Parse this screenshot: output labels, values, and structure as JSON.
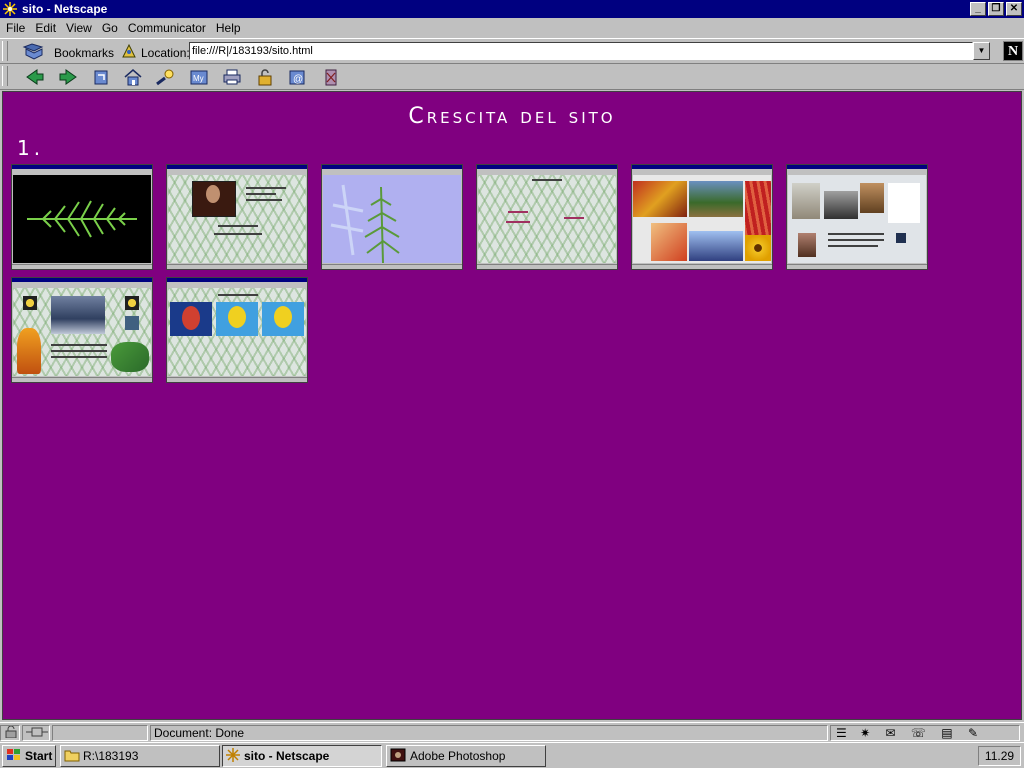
{
  "window": {
    "title": "sito - Netscape"
  },
  "menu": [
    {
      "label": "File"
    },
    {
      "label": "Edit"
    },
    {
      "label": "View"
    },
    {
      "label": "Go"
    },
    {
      "label": "Communicator"
    },
    {
      "label": "Help"
    }
  ],
  "location": {
    "bookmarks_label": "Bookmarks",
    "location_label": "Location:",
    "url": "file:///R|/183193/sito.html"
  },
  "toolbar_icons": [
    "back-icon",
    "forward-icon",
    "reload-icon",
    "home-icon",
    "search-icon",
    "my-netscape-icon",
    "print-icon",
    "security-icon",
    "shop-icon",
    "stop-icon"
  ],
  "page": {
    "title": "Crescita del sito",
    "section": "1."
  },
  "thumbnails": [
    {
      "id": "fern-black"
    },
    {
      "id": "portrait-page"
    },
    {
      "id": "fern-blue"
    },
    {
      "id": "fern-pattern"
    },
    {
      "id": "photo-collage"
    },
    {
      "id": "portrait-collage"
    },
    {
      "id": "comic-page"
    },
    {
      "id": "faces-page"
    }
  ],
  "status": {
    "text": "Document: Done"
  },
  "taskbar": {
    "start": "Start",
    "tasks": [
      {
        "label": "R:\\183193"
      },
      {
        "label": "sito - Netscape"
      },
      {
        "label": "Adobe Photoshop"
      }
    ],
    "clock": "11.29"
  },
  "colors": {
    "page_bg": "#800080",
    "titlebar": "#000080",
    "chrome": "#c0c0c0"
  }
}
